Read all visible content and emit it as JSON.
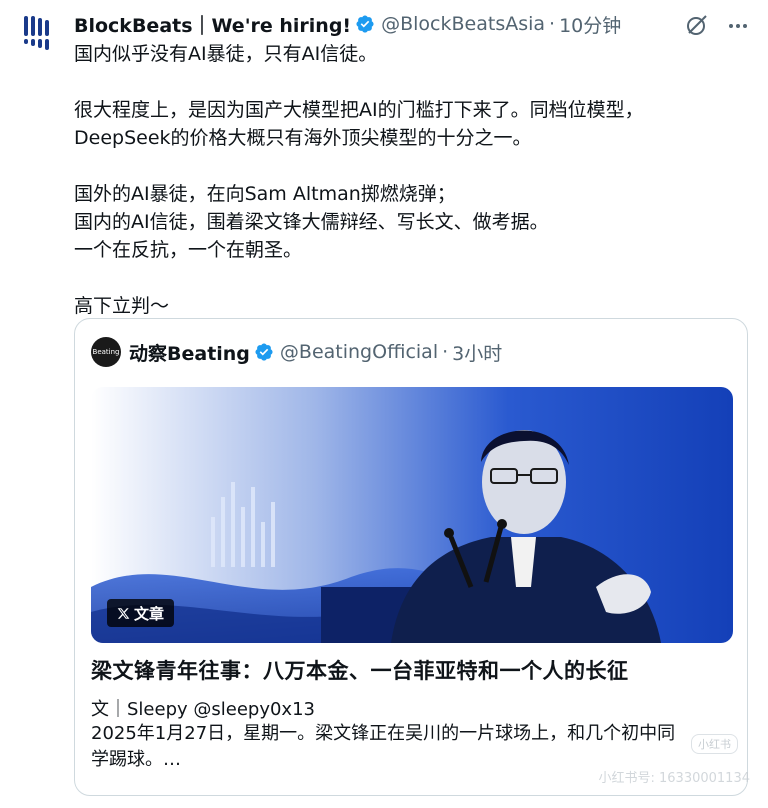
{
  "tweet": {
    "display_name": "BlockBeats｜We're hiring!",
    "handle": "@BlockBeatsAsia",
    "separator": "·",
    "time": "10分钟",
    "lines": [
      "国内似乎没有AI暴徒，只有AI信徒。",
      "",
      "很大程度上，是因为国产大模型把AI的门槛打下来了。同档位模型，",
      "DeepSeek的价格大概只有海外顶尖模型的十分之一。",
      "",
      "国外的AI暴徒，在向Sam Altman掷燃烧弹；",
      "国内的AI信徒，围着梁文锋大儒辩经、写长文、做考据。",
      "一个在反抗，一个在朝圣。",
      "",
      "高下立判～"
    ]
  },
  "quote": {
    "avatar_text": "Beating",
    "display_name": "动察Beating",
    "handle": "@BeatingOfficial",
    "separator": "·",
    "time": "3小时",
    "badge_label": "文章",
    "title": "梁文锋青年往事：八万本金、一台菲亚特和一个人的长征",
    "byline": "文｜Sleepy @sleepy0x13",
    "summary_lines": [
      "2025年1月27日，星期一。梁文锋正在吴川的一片球场上，和几个初中同",
      "学踢球。…"
    ]
  },
  "watermark": {
    "text": "小红书号: 16330001134",
    "logo_text": "小红书"
  },
  "colors": {
    "verified": "#1d9bf0",
    "image_blue": "#1f4fc9",
    "text": "#0f1419",
    "muted": "#536471"
  },
  "icons": {
    "avatar": "blockbeats-logo-icon",
    "verified": "verified-badge-icon",
    "grok": "grok-icon",
    "more": "more-icon",
    "x_logo": "x-logo-icon"
  }
}
